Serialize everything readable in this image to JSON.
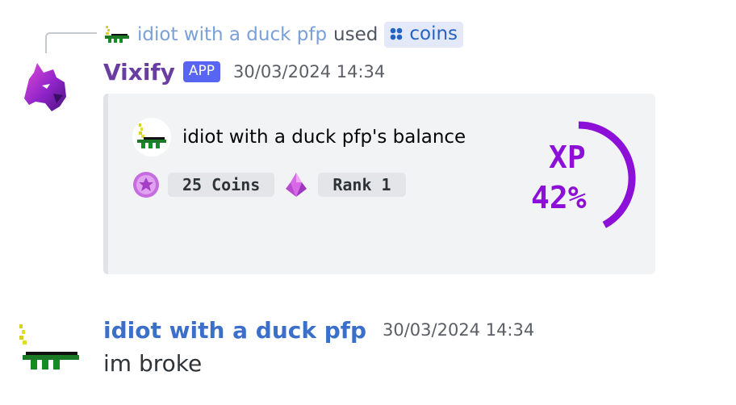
{
  "reply": {
    "user": "idiot with a duck pfp",
    "used_text": "used",
    "command": "coins"
  },
  "bot_message": {
    "author": "Vixify",
    "badge": "APP",
    "timestamp": "30/03/2024 14:34",
    "embed": {
      "title": "idiot with a duck pfp's balance",
      "coins_label": "25 Coins",
      "rank_label": "Rank 1",
      "xp": {
        "label": "XP",
        "percent_text": "42%",
        "percent": 42
      }
    }
  },
  "user_message": {
    "author": "idiot with a duck pfp",
    "timestamp": "30/03/2024 14:34",
    "content": "im broke"
  },
  "colors": {
    "bot_name": "#6a3ea1",
    "user_name": "#3b6fc9",
    "app_badge": "#5865f2",
    "xp_purple": "#8c10d8"
  },
  "icons": [
    "duck-avatar-icon",
    "wolf-avatar-icon",
    "slash-command-icon",
    "coin-icon",
    "rank-crystal-icon"
  ]
}
